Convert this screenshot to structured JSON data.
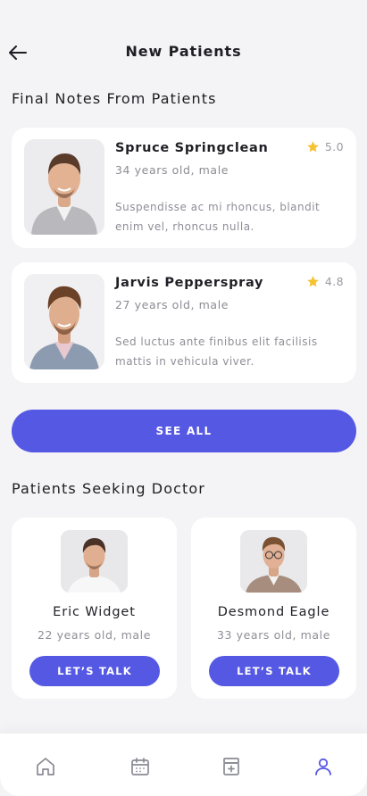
{
  "header": {
    "title": "New Patients"
  },
  "notes": {
    "title": "Final Notes From Patients",
    "items": [
      {
        "name": "Spruce Springclean",
        "meta": "34 years old, male",
        "rating": "5.0",
        "text": "Suspendisse ac mi rhoncus, blandit enim vel, rhoncus nulla."
      },
      {
        "name": "Jarvis Pepperspray",
        "meta": "27 years old, male",
        "rating": "4.8",
        "text": "Sed luctus ante finibus elit facilisis mattis in vehicula viver."
      }
    ],
    "see_all_label": "SEE ALL"
  },
  "seeking": {
    "title": "Patients Seeking Doctor",
    "items": [
      {
        "name": "Eric Widget",
        "meta": "22 years old, male",
        "button": "LET’S TALK"
      },
      {
        "name": "Desmond Eagle",
        "meta": "33 years old, male",
        "button": "LET’S TALK"
      }
    ]
  },
  "nav": {
    "items": [
      {
        "icon": "home-icon"
      },
      {
        "icon": "calendar-icon"
      },
      {
        "icon": "medical-box-icon"
      },
      {
        "icon": "user-icon"
      }
    ]
  },
  "colors": {
    "accent": "#5558e3",
    "star": "#f5c232",
    "active_nav": "#5558e3",
    "inactive_nav": "#8a8a94"
  }
}
